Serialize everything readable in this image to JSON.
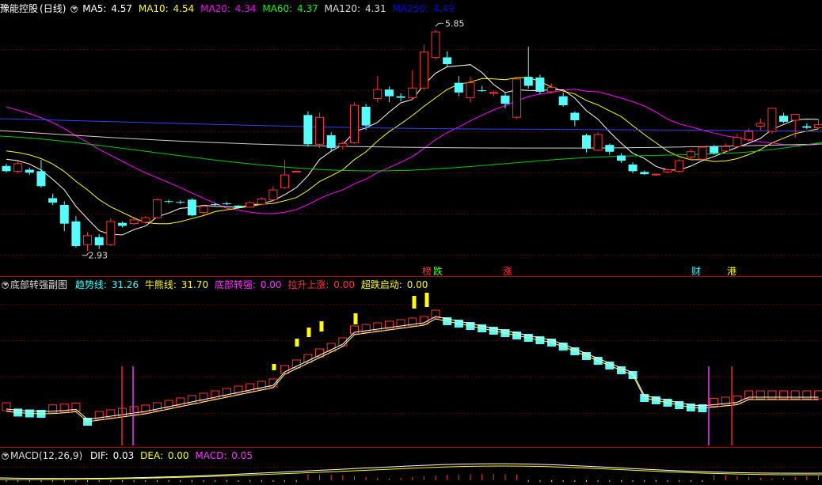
{
  "stock": {
    "name": "豫能控股",
    "period": "(日线)"
  },
  "ma_legend": [
    {
      "label": "MA5:",
      "value": "4.57",
      "color": "#ffffff"
    },
    {
      "label": "MA10:",
      "value": "4.54",
      "color": "#ffff00"
    },
    {
      "label": "MA20:",
      "value": "4.34",
      "color": "#ff00ff"
    },
    {
      "label": "MA60:",
      "value": "4.37",
      "color": "#00ff00"
    },
    {
      "label": "MA120:",
      "value": "4.31",
      "color": "#dcdcdc"
    },
    {
      "label": "MA250:",
      "value": "4.49",
      "color": "#0000ff"
    }
  ],
  "price_annotations": {
    "high": "5.85",
    "low": "2.93"
  },
  "event_tags": [
    {
      "text": "榜",
      "color": "#ff3333"
    },
    {
      "text": "跌",
      "color": "#33ff33"
    },
    {
      "text": "涨",
      "color": "#ff3333"
    },
    {
      "text": "财",
      "color": "#00ffff"
    },
    {
      "text": "港",
      "color": "#ffff00"
    }
  ],
  "sub_indicator": {
    "title": "底部转强副图",
    "items": [
      {
        "label": "趋势线:",
        "value": "31.26",
        "color": "#33ffff"
      },
      {
        "label": "牛熊线:",
        "value": "31.70",
        "color": "#ffff00"
      },
      {
        "label": "底部转强:",
        "value": "0.00",
        "color": "#ff33ff"
      },
      {
        "label": "拉升上涨:",
        "value": "0.00",
        "color": "#ff3333"
      },
      {
        "label": "超跌启动:",
        "value": "0.00",
        "color": "#ffff00"
      }
    ]
  },
  "macd": {
    "title": "MACD(12,26,9)",
    "items": [
      {
        "label": "DIF:",
        "value": "0.03",
        "color": "#ffffff"
      },
      {
        "label": "DEA:",
        "value": "0.00",
        "color": "#ffff00"
      },
      {
        "label": "MACD:",
        "value": "0.05",
        "color": "#ff33ff"
      }
    ]
  },
  "chart_data": {
    "type": "candlestick",
    "price_range": [
      2.8,
      6.0
    ],
    "candles": [
      [
        4.07,
        4.0,
        4.1,
        3.98
      ],
      [
        4.0,
        4.1,
        4.13,
        3.97
      ],
      [
        4.02,
        3.98,
        4.05,
        3.95
      ],
      [
        4.0,
        3.8,
        4.15,
        3.78
      ],
      [
        3.64,
        3.58,
        3.7,
        3.55
      ],
      [
        3.55,
        3.3,
        3.6,
        3.2
      ],
      [
        3.33,
        3.0,
        3.4,
        2.98
      ],
      [
        3.02,
        3.14,
        3.19,
        2.93
      ],
      [
        3.12,
        3.01,
        3.16,
        2.96
      ],
      [
        3.02,
        3.33,
        3.37,
        3.0
      ],
      [
        3.31,
        3.27,
        3.33,
        3.25
      ],
      [
        3.3,
        3.35,
        3.37,
        3.28
      ],
      [
        3.32,
        3.38,
        3.4,
        3.3
      ],
      [
        3.38,
        3.62,
        3.64,
        3.37
      ],
      [
        3.6,
        3.59,
        3.62,
        3.57
      ],
      [
        3.59,
        3.58,
        3.61,
        3.56
      ],
      [
        3.62,
        3.41,
        3.64,
        3.4
      ],
      [
        3.45,
        3.53,
        3.55,
        3.42
      ],
      [
        3.56,
        3.55,
        3.58,
        3.53
      ],
      [
        3.57,
        3.56,
        3.59,
        3.55
      ],
      [
        3.54,
        3.52,
        3.55,
        3.5
      ],
      [
        3.52,
        3.58,
        3.6,
        3.51
      ],
      [
        3.56,
        3.63,
        3.65,
        3.55
      ],
      [
        3.62,
        3.75,
        3.8,
        3.6
      ],
      [
        3.78,
        3.95,
        4.15,
        3.76
      ],
      [
        4.0,
        4.0,
        4.0,
        4.0
      ],
      [
        4.75,
        4.36,
        4.8,
        4.33
      ],
      [
        4.36,
        4.72,
        4.78,
        4.31
      ],
      [
        4.48,
        4.31,
        4.52,
        4.26
      ],
      [
        4.33,
        4.37,
        4.4,
        4.29
      ],
      [
        4.38,
        4.88,
        4.92,
        4.36
      ],
      [
        4.86,
        4.61,
        4.9,
        4.55
      ],
      [
        4.97,
        5.09,
        5.27,
        4.92
      ],
      [
        5.09,
        5.0,
        5.13,
        4.92
      ],
      [
        5.0,
        4.98,
        5.04,
        4.93
      ],
      [
        4.98,
        5.11,
        5.35,
        4.95
      ],
      [
        5.11,
        5.59,
        5.69,
        5.08
      ],
      [
        5.52,
        5.86,
        5.89,
        5.49
      ],
      [
        5.52,
        5.43,
        5.6,
        5.4
      ],
      [
        5.18,
        5.05,
        5.27,
        5.0
      ],
      [
        4.98,
        5.18,
        5.26,
        4.92
      ],
      [
        5.08,
        5.07,
        5.14,
        5.06
      ],
      [
        5.05,
        5.05,
        5.08,
        5.0
      ],
      [
        5.01,
        4.9,
        5.06,
        4.84
      ],
      [
        4.72,
        5.23,
        5.24,
        4.7
      ],
      [
        5.26,
        5.14,
        5.66,
        5.1
      ],
      [
        5.25,
        5.06,
        5.29,
        5.03
      ],
      [
        5.06,
        5.12,
        5.17,
        5.04
      ],
      [
        5.0,
        4.88,
        5.05,
        4.86
      ],
      [
        4.78,
        4.68,
        4.8,
        4.6
      ],
      [
        4.48,
        4.3,
        4.5,
        4.25
      ],
      [
        4.28,
        4.49,
        4.52,
        4.27
      ],
      [
        4.35,
        4.26,
        4.37,
        4.22
      ],
      [
        4.21,
        4.14,
        4.24,
        4.11
      ],
      [
        4.09,
        4.0,
        4.12,
        3.97
      ],
      [
        3.99,
        3.96,
        4.01,
        3.95
      ],
      [
        3.96,
        3.96,
        3.97,
        3.94
      ],
      [
        3.99,
        4.02,
        4.04,
        3.97
      ],
      [
        4.0,
        4.14,
        4.16,
        3.98
      ],
      [
        4.19,
        4.26,
        4.29,
        4.15
      ],
      [
        4.16,
        4.32,
        4.34,
        4.14
      ],
      [
        4.33,
        4.24,
        4.35,
        4.22
      ],
      [
        4.27,
        4.33,
        4.37,
        4.25
      ],
      [
        4.33,
        4.45,
        4.5,
        4.31
      ],
      [
        4.42,
        4.53,
        4.57,
        4.39
      ],
      [
        4.6,
        4.64,
        4.7,
        4.55
      ],
      [
        4.53,
        4.84,
        4.85,
        4.5
      ],
      [
        4.74,
        4.66,
        4.78,
        4.64
      ],
      [
        4.68,
        4.76,
        4.76,
        4.45
      ],
      [
        4.6,
        4.58,
        4.64,
        4.56
      ],
      [
        4.58,
        4.62,
        4.69,
        4.57
      ]
    ]
  }
}
